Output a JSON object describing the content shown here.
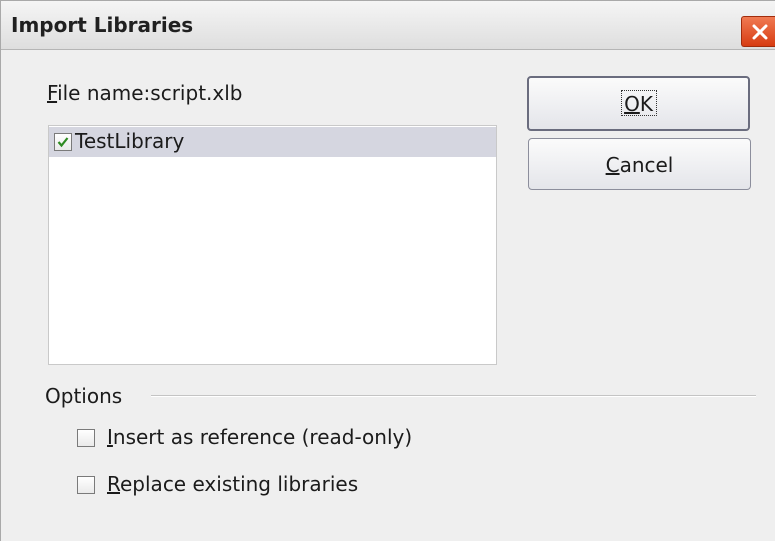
{
  "window": {
    "title": "Import Libraries"
  },
  "file": {
    "label_mnemonic": "F",
    "label_rest": "ile name:",
    "value": "script.xlb"
  },
  "library_list": {
    "items": [
      {
        "label": "TestLibrary",
        "checked": true
      }
    ]
  },
  "buttons": {
    "ok_mnemonic": "O",
    "ok_rest": "K",
    "cancel_mnemonic": "C",
    "cancel_rest": "ancel"
  },
  "options": {
    "heading": "Options",
    "insert_reference": {
      "mnemonic": "I",
      "rest": "nsert as reference (read-only)",
      "checked": false
    },
    "replace_existing": {
      "mnemonic": "R",
      "rest": "eplace existing libraries",
      "checked": false
    }
  },
  "colors": {
    "close_button": "#d73c12",
    "selection": "#d5d6e0",
    "check": "#2e8b22"
  },
  "icons": {
    "close": "close-icon",
    "check": "checkmark-icon"
  }
}
